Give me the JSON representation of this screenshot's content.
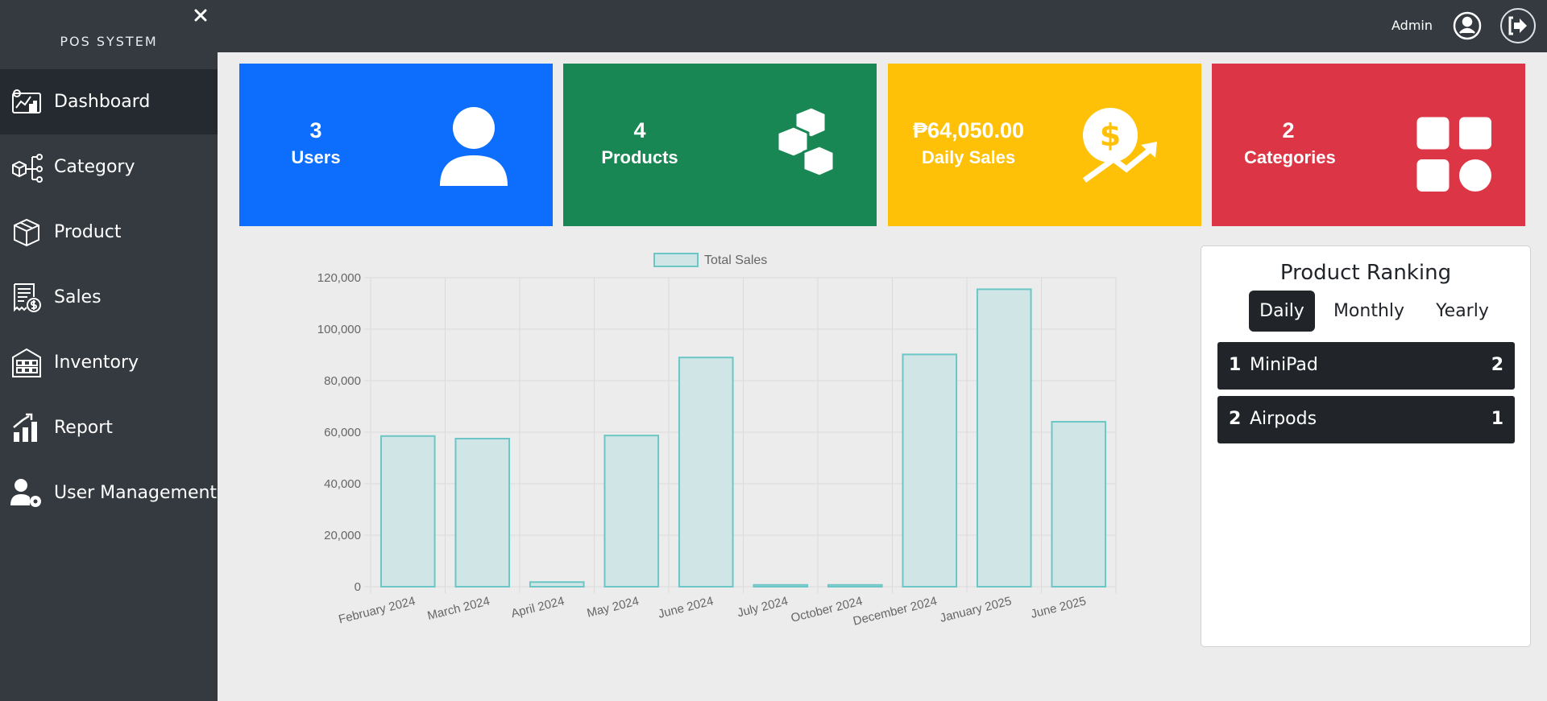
{
  "sidebar": {
    "brand": "POS SYSTEM",
    "items": [
      {
        "label": "Dashboard",
        "icon": "dashboard-icon",
        "active": true
      },
      {
        "label": "Category",
        "icon": "category-icon"
      },
      {
        "label": "Product",
        "icon": "product-box-icon"
      },
      {
        "label": "Sales",
        "icon": "sales-receipt-icon"
      },
      {
        "label": "Inventory",
        "icon": "inventory-icon"
      },
      {
        "label": "Report",
        "icon": "report-chart-icon"
      },
      {
        "label": "User Management",
        "icon": "user-management-icon"
      }
    ]
  },
  "topbar": {
    "user_label": "Admin"
  },
  "cards": [
    {
      "value": "3",
      "label": "Users",
      "color": "#0d6efd",
      "icon": "user-icon"
    },
    {
      "value": "4",
      "label": "Products",
      "color": "#198754",
      "icon": "boxes-icon"
    },
    {
      "value": "₱64,050.00",
      "label": "Daily Sales",
      "color": "#ffc107",
      "icon": "sales-growth-icon"
    },
    {
      "value": "2",
      "label": "Categories",
      "color": "#dc3545",
      "icon": "categories-grid-icon"
    }
  ],
  "chart_data": {
    "type": "bar",
    "categories": [
      "February 2024",
      "March 2024",
      "April 2024",
      "May 2024",
      "June 2024",
      "July 2024",
      "October 2024",
      "December 2024",
      "January 2025",
      "June 2025"
    ],
    "series": [
      {
        "name": "Total Sales",
        "values": [
          58500,
          57500,
          1800,
          58700,
          89000,
          700,
          700,
          90200,
          115500,
          64050
        ]
      }
    ],
    "ylim": [
      0,
      120000
    ],
    "yticks": [
      "0",
      "20,000",
      "40,000",
      "60,000",
      "80,000",
      "100,000",
      "120,000"
    ],
    "legend_position": "top",
    "grid": true,
    "colors": {
      "fill": "#cfe5e6",
      "stroke": "#6cc6c5"
    }
  },
  "ranking": {
    "title": "Product Ranking",
    "tabs": [
      {
        "label": "Daily",
        "active": true
      },
      {
        "label": "Monthly"
      },
      {
        "label": "Yearly"
      }
    ],
    "rows": [
      {
        "rank": "1",
        "name": "MiniPad",
        "count": "2"
      },
      {
        "rank": "2",
        "name": "Airpods",
        "count": "1"
      }
    ]
  }
}
